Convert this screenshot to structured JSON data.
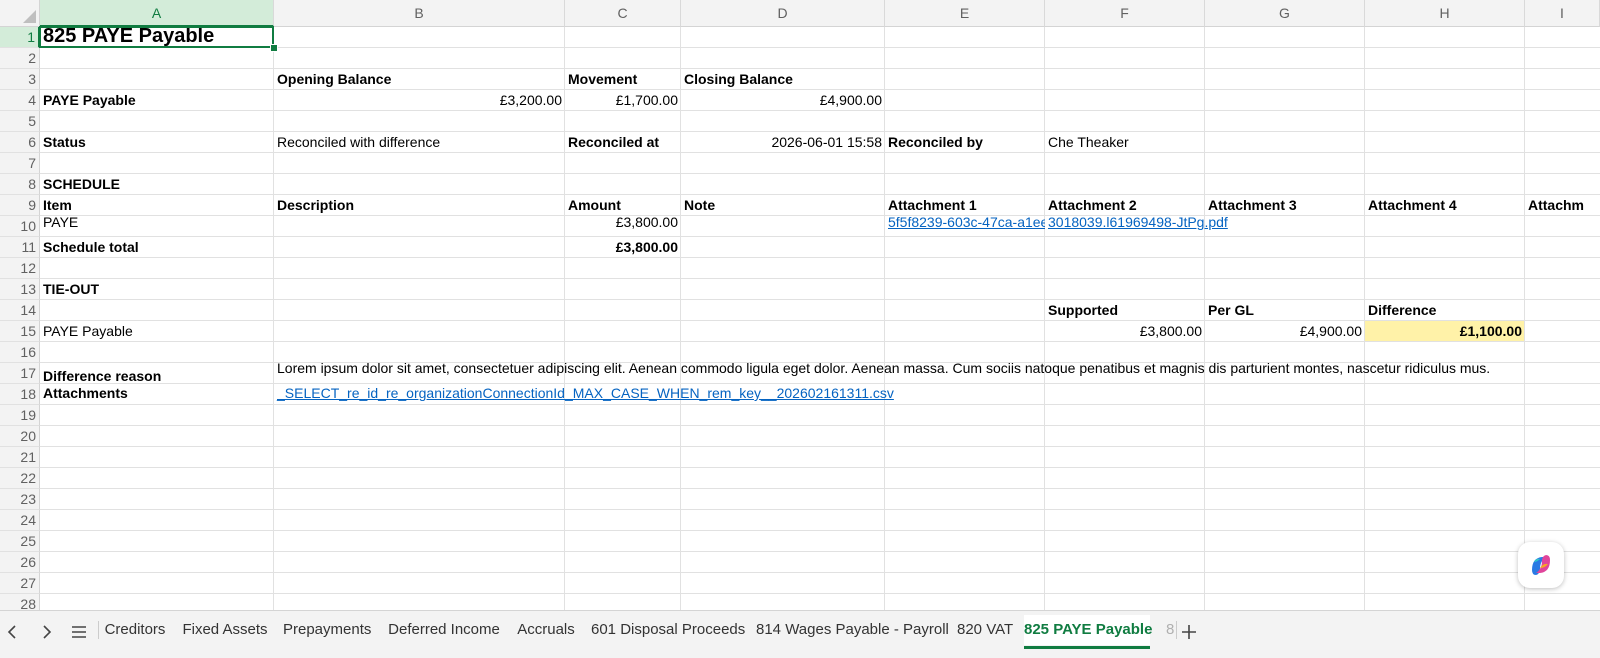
{
  "columns": [
    "A",
    "B",
    "C",
    "D",
    "E",
    "F",
    "G",
    "H",
    "I"
  ],
  "rows": [
    "1",
    "2",
    "3",
    "4",
    "5",
    "6",
    "7",
    "8",
    "9",
    "10",
    "11",
    "12",
    "13",
    "14",
    "15",
    "16",
    "17",
    "18",
    "19",
    "20",
    "21",
    "22",
    "23",
    "24",
    "25",
    "26",
    "27",
    "28"
  ],
  "sheet": {
    "title": "825 PAYE Payable",
    "opening_balance_label": "Opening Balance",
    "movement_label": "Movement",
    "closing_balance_label": "Closing Balance",
    "account_label": "PAYE Payable",
    "opening_balance": "£3,200.00",
    "movement": "£1,700.00",
    "closing_balance": "£4,900.00",
    "status_label": "Status",
    "status_value": "Reconciled with difference",
    "reconciled_at_label": "Reconciled at",
    "reconciled_at_value": "2026-06-01 15:58",
    "reconciled_by_label": "Reconciled by",
    "reconciled_by_value": "Che Theaker",
    "schedule_heading": "SCHEDULE",
    "schedule_headers": [
      "Item",
      "Description",
      "Amount",
      "Note",
      "Attachment 1",
      "Attachment 2",
      "Attachment 3",
      "Attachment 4",
      "Attachm"
    ],
    "schedule_row": {
      "item": "PAYE",
      "amount": "£3,800.00",
      "attachment1": "5f5f8239-603c-47ca-a1ee",
      "attachment2": "3018039.l61969498-JtPg.pdf"
    },
    "schedule_total_label": "Schedule total",
    "schedule_total": "£3,800.00",
    "tieout_heading": "TIE-OUT",
    "tieout_headers": [
      "Supported",
      "Per GL",
      "Difference"
    ],
    "tieout_row_label": "PAYE Payable",
    "supported": "£3,800.00",
    "per_gl": "£4,900.00",
    "difference": "£1,100.00",
    "difference_reason_label": "Difference reason",
    "difference_reason": "Lorem ipsum dolor sit amet, consectetuer adipiscing elit. Aenean commodo ligula eget dolor. Aenean massa. Cum sociis natoque penatibus et magnis dis parturient montes, nascetur ridiculus mus. Donec",
    "attachments_label": "Attachments",
    "attachments_value": "_SELECT_re_id_re_organizationConnectionId_MAX_CASE_WHEN_rem_key__202602161311.csv"
  },
  "colors": {
    "accent": "#107c41",
    "highlight": "#fff2a8",
    "link": "#0563c1"
  },
  "tabs": [
    "Creditors",
    "Fixed Assets",
    "Prepayments",
    "Deferred Income",
    "Accruals",
    "601 Disposal Proceeds",
    "814 Wages Payable - Payroll",
    "820 VAT",
    "825 PAYE Payable",
    "8"
  ],
  "active_tab": "825 PAYE Payable",
  "icons": {
    "prev": "chevron-left-icon",
    "next": "chevron-right-icon",
    "menu": "hamburger-menu-icon",
    "add": "plus-icon",
    "copilot": "copilot-icon"
  }
}
